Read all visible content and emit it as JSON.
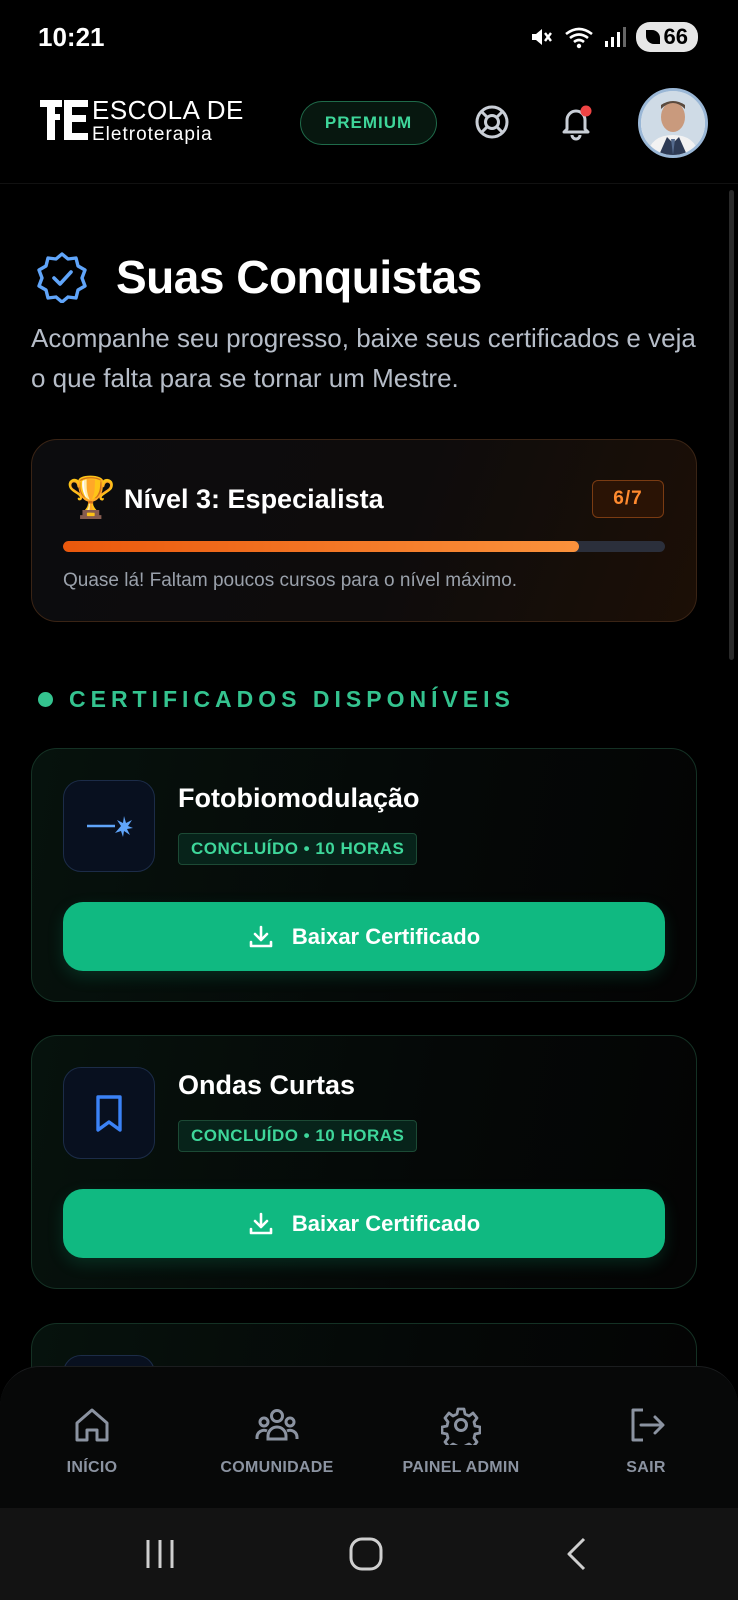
{
  "status_bar": {
    "time": "10:21",
    "battery": "66"
  },
  "header": {
    "logo_line1": "ESCOLA DE",
    "logo_line2": "Eletroterapia",
    "premium_label": "PREMIUM"
  },
  "page": {
    "title": "Suas Conquistas",
    "subtitle": "Acompanhe seu progresso, baixe seus certificados e veja o que falta para se tornar um Mestre."
  },
  "level": {
    "title": "Nível 3: Especialista",
    "count": "6/7",
    "progress_fraction": 0.857,
    "hint": "Quase lá! Faltam poucos cursos para o nível máximo."
  },
  "section": {
    "title": "CERTIFICADOS DISPONÍVEIS"
  },
  "certificates": [
    {
      "title": "Fotobiomodulação",
      "badge": "CONCLUÍDO • 10 HORAS",
      "button": "Baixar Certificado",
      "icon": "laser-icon"
    },
    {
      "title": "Ondas Curtas",
      "badge": "CONCLUÍDO • 10 HORAS",
      "button": "Baixar Certificado",
      "icon": "book-icon"
    },
    {
      "title": "",
      "badge": "",
      "button": "",
      "icon": ""
    }
  ],
  "bottom_nav": [
    {
      "label": "INÍCIO",
      "icon": "home-icon"
    },
    {
      "label": "COMUNIDADE",
      "icon": "users-icon"
    },
    {
      "label": "PAINEL ADMIN",
      "icon": "gear-icon"
    },
    {
      "label": "SAIR",
      "icon": "logout-icon"
    }
  ],
  "colors": {
    "accent_green": "#10b981",
    "accent_orange": "#f97316",
    "accent_blue": "#60a5fa",
    "background": "#000000"
  }
}
